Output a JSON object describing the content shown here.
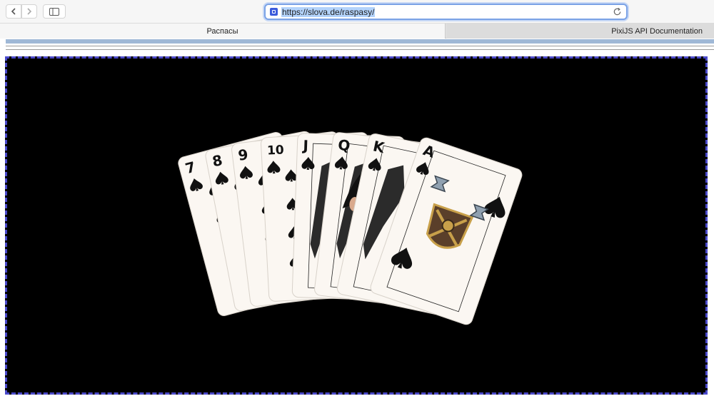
{
  "browser": {
    "url": "https://slova.de/raspasy/",
    "tabs": [
      {
        "label": "Распасы",
        "active": true
      },
      {
        "label": "PixiJS API Documentation",
        "active": false
      }
    ]
  },
  "game": {
    "cards": [
      {
        "rank": "7",
        "suit": "spades"
      },
      {
        "rank": "8",
        "suit": "spades"
      },
      {
        "rank": "9",
        "suit": "spades"
      },
      {
        "rank": "10",
        "suit": "spades"
      },
      {
        "rank": "J",
        "suit": "spades"
      },
      {
        "rank": "Q",
        "suit": "spades"
      },
      {
        "rank": "K",
        "suit": "spades"
      },
      {
        "rank": "A",
        "suit": "spades"
      }
    ]
  },
  "colors": {
    "stage_bg": "#000000",
    "card_face": "#fbf7f2",
    "ink": "#111111"
  }
}
